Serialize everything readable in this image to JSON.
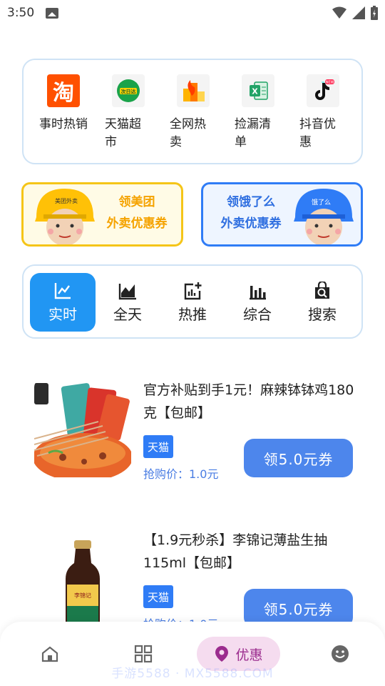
{
  "status": {
    "time": "3:50"
  },
  "categories": [
    {
      "label": "事时热销",
      "icon": "taobao-icon"
    },
    {
      "label": "天猫超市",
      "icon": "tmall-supermarket-icon"
    },
    {
      "label": "全网热卖",
      "icon": "hot-sale-icon"
    },
    {
      "label": "捡漏清单",
      "icon": "excel-list-icon"
    },
    {
      "label": "抖音优惠",
      "icon": "douyin-icon"
    }
  ],
  "banners": {
    "meituan": {
      "line1": "领美团",
      "line2": "外卖优惠券",
      "logo": "美团外卖"
    },
    "eleme": {
      "line1": "领饿了么",
      "line2": "外卖优惠券",
      "logo": "饿了么"
    }
  },
  "tabs": [
    {
      "label": "实时",
      "icon": "realtime-chart-icon",
      "active": true
    },
    {
      "label": "全天",
      "icon": "area-chart-icon",
      "active": false
    },
    {
      "label": "热推",
      "icon": "hot-push-icon",
      "active": false
    },
    {
      "label": "综合",
      "icon": "bar-chart-icon",
      "active": false
    },
    {
      "label": "搜索",
      "icon": "search-bag-icon",
      "active": false
    }
  ],
  "products": [
    {
      "title": "官方补贴到手1元！麻辣钵钵鸡180克【包邮】",
      "tag": "天猫",
      "price": "抢购价：1.0元",
      "coupon": "领5.0元券"
    },
    {
      "title": "【1.9元秒杀】李锦记薄盐生抽115ml【包邮】",
      "tag": "天猫",
      "price": "抢购价：1.0元",
      "coupon": "领5.0元券"
    }
  ],
  "bottom_nav": {
    "home_icon": "home-icon",
    "grid_icon": "grid-icon",
    "active_label": "优惠",
    "profile_icon": "smiley-icon"
  },
  "watermark": "手游5588 · MX5588.COM",
  "colors": {
    "accent": "#2196f3",
    "coupon": "#4d86ec",
    "meituan": "#f5c518",
    "eleme": "#2f7cf6",
    "nav_active_bg": "#f5dcef",
    "nav_active_text": "#9b2c8e"
  }
}
